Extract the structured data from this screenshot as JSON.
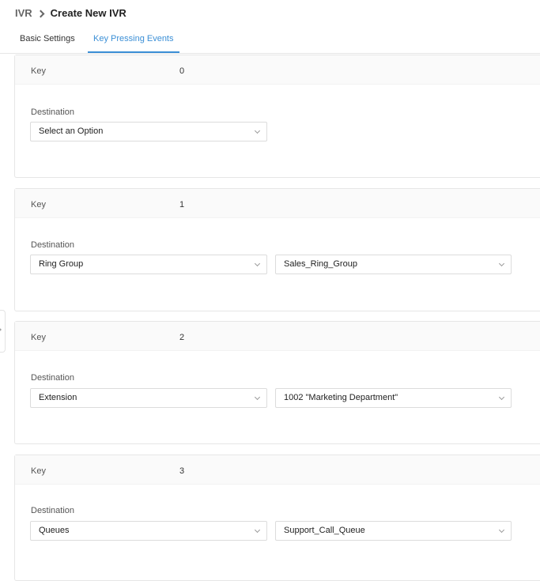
{
  "breadcrumb": {
    "root": "IVR",
    "current": "Create New IVR"
  },
  "tabs": [
    {
      "label": "Basic Settings",
      "active": false
    },
    {
      "label": "Key Pressing Events",
      "active": true
    }
  ],
  "labels": {
    "key": "Key",
    "destination": "Destination"
  },
  "events": [
    {
      "key": "0",
      "destination": "Select an Option",
      "target": ""
    },
    {
      "key": "1",
      "destination": "Ring Group",
      "target": "Sales_Ring_Group"
    },
    {
      "key": "2",
      "destination": "Extension",
      "target": "1002 \"Marketing Department\""
    },
    {
      "key": "3",
      "destination": "Queues",
      "target": "Support_Call_Queue"
    }
  ],
  "colors": {
    "accent": "#3b8fd6"
  }
}
